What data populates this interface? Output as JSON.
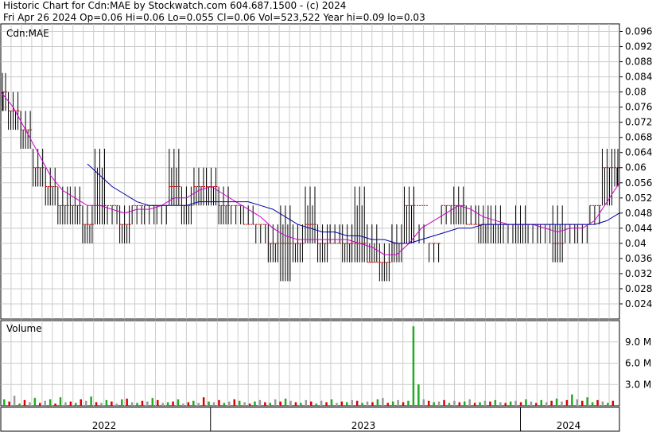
{
  "header": {
    "line1": "Historic Chart for Cdn:MAE by Stockwatch.com 604.687.1500 - (c) 2024",
    "line2": "Fri Apr 26 2024   Op=0.06   Hi=0.06   Lo=0.055   Cl=0.06   Vol=523,522   Year hi=0.09   lo=0.03"
  },
  "colors": {
    "price_bar": "#000000",
    "close_tick": "#cc0000",
    "ma_short": "#cc00cc",
    "ma_long": "#0000aa",
    "volume_up": "#22aa22",
    "volume_down": "#dd0000",
    "volume_flat": "#999999",
    "grid": "#cccccc"
  },
  "chart_data": [
    {
      "type": "bar",
      "title": "Cdn:MAE",
      "ylim": [
        0.02,
        0.098
      ],
      "y_ticks": [
        "0.096",
        "0.092",
        "0.088",
        "0.084",
        "0.08",
        "0.076",
        "0.072",
        "0.068",
        "0.064",
        "0.06",
        "0.056",
        "0.052",
        "0.048",
        "0.044",
        "0.04",
        "0.036",
        "0.032",
        "0.028",
        "0.024"
      ],
      "x_labels": [
        "2022",
        "2023",
        "2024"
      ],
      "x_boundaries": [
        0.0,
        0.339,
        0.84,
        1.0
      ],
      "grid": true,
      "series": [
        {
          "kind": "ohlc",
          "x": [
            0.0,
            0.02,
            0.04,
            0.06,
            0.08,
            0.1,
            0.12,
            0.14,
            0.16,
            0.18,
            0.2,
            0.22,
            0.24,
            0.26,
            0.28,
            0.3,
            0.32,
            0.34,
            0.36,
            0.38,
            0.4,
            0.42,
            0.44,
            0.46,
            0.48,
            0.5,
            0.52,
            0.54,
            0.56,
            0.58,
            0.6,
            0.62,
            0.64,
            0.66,
            0.68,
            0.7,
            0.72,
            0.74,
            0.76,
            0.78,
            0.8,
            0.82,
            0.84,
            0.86,
            0.88,
            0.9,
            0.92,
            0.94,
            0.96,
            0.98,
            1.0
          ],
          "high": [
            0.085,
            0.08,
            0.075,
            0.065,
            0.06,
            0.055,
            0.055,
            0.05,
            0.065,
            0.05,
            0.05,
            0.05,
            0.05,
            0.05,
            0.065,
            0.055,
            0.06,
            0.06,
            0.055,
            0.05,
            0.05,
            0.045,
            0.045,
            0.05,
            0.045,
            0.055,
            0.045,
            0.045,
            0.045,
            0.055,
            0.045,
            0.04,
            0.045,
            0.055,
            0.045,
            0.04,
            0.05,
            0.055,
            0.05,
            0.05,
            0.05,
            0.045,
            0.05,
            0.045,
            0.045,
            0.05,
            0.045,
            0.045,
            0.05,
            0.065,
            0.065
          ],
          "low": [
            0.075,
            0.07,
            0.065,
            0.055,
            0.05,
            0.045,
            0.045,
            0.04,
            0.045,
            0.045,
            0.04,
            0.045,
            0.045,
            0.045,
            0.05,
            0.045,
            0.05,
            0.05,
            0.045,
            0.045,
            0.045,
            0.04,
            0.035,
            0.03,
            0.035,
            0.04,
            0.035,
            0.04,
            0.035,
            0.035,
            0.035,
            0.03,
            0.035,
            0.04,
            0.045,
            0.035,
            0.045,
            0.045,
            0.045,
            0.04,
            0.04,
            0.04,
            0.04,
            0.04,
            0.04,
            0.035,
            0.04,
            0.04,
            0.045,
            0.05,
            0.055
          ],
          "close": [
            0.08,
            0.075,
            0.07,
            0.06,
            0.055,
            0.05,
            0.05,
            0.045,
            0.05,
            0.05,
            0.045,
            0.05,
            0.05,
            0.05,
            0.055,
            0.05,
            0.055,
            0.055,
            0.05,
            0.05,
            0.045,
            0.045,
            0.04,
            0.04,
            0.04,
            0.045,
            0.04,
            0.04,
            0.04,
            0.04,
            0.035,
            0.035,
            0.04,
            0.05,
            0.05,
            0.04,
            0.05,
            0.05,
            0.045,
            0.045,
            0.045,
            0.045,
            0.045,
            0.045,
            0.045,
            0.04,
            0.045,
            0.045,
            0.05,
            0.06,
            0.06
          ]
        },
        {
          "kind": "line",
          "values": [
            0.08,
            0.076,
            0.07,
            0.064,
            0.058,
            0.054,
            0.052,
            0.05,
            0.05,
            0.049,
            0.048,
            0.049,
            0.049,
            0.05,
            0.052,
            0.052,
            0.054,
            0.055,
            0.053,
            0.051,
            0.049,
            0.047,
            0.044,
            0.042,
            0.041,
            0.041,
            0.041,
            0.041,
            0.041,
            0.04,
            0.039,
            0.037,
            0.037,
            0.04,
            0.044,
            0.046,
            0.048,
            0.05,
            0.049,
            0.047,
            0.046,
            0.045,
            0.045,
            0.045,
            0.044,
            0.043,
            0.044,
            0.044,
            0.046,
            0.051,
            0.056
          ]
        },
        {
          "kind": "line",
          "values": [
            null,
            null,
            null,
            null,
            null,
            null,
            null,
            0.061,
            0.058,
            0.055,
            0.053,
            0.051,
            0.05,
            0.05,
            0.05,
            0.05,
            0.051,
            0.051,
            0.051,
            0.051,
            0.051,
            0.05,
            0.049,
            0.047,
            0.045,
            0.044,
            0.043,
            0.043,
            0.042,
            0.042,
            0.041,
            0.041,
            0.04,
            0.04,
            0.041,
            0.042,
            0.043,
            0.044,
            0.044,
            0.045,
            0.045,
            0.045,
            0.045,
            0.045,
            0.045,
            0.045,
            0.045,
            0.045,
            0.045,
            0.046,
            0.048
          ]
        }
      ]
    },
    {
      "type": "bar",
      "title": "Volume",
      "ylim": [
        0,
        12
      ],
      "y_ticks": [
        "9.0 M",
        "6.0 M",
        "3.0 M"
      ],
      "values": [
        0.9,
        0.6,
        1.4,
        0.3,
        0.8,
        0.5,
        1.1,
        0.4,
        0.7,
        0.9,
        0.3,
        1.2,
        0.5,
        0.6,
        0.4,
        0.9,
        0.7,
        1.3,
        0.5,
        0.4,
        0.8,
        0.6,
        0.3,
        0.9,
        1.0,
        0.5,
        0.4,
        0.7,
        0.6,
        1.1,
        0.8,
        0.4,
        0.5,
        0.6,
        0.9,
        0.3,
        0.5,
        0.7,
        0.4,
        1.2,
        0.6,
        0.5,
        0.8,
        0.4,
        0.6,
        0.9,
        0.7,
        0.5,
        0.3,
        0.6,
        0.8,
        0.5,
        0.4,
        0.9,
        0.6,
        1.0,
        0.7,
        0.5,
        0.4,
        0.8,
        0.6,
        0.3,
        0.7,
        0.5,
        0.9,
        0.4,
        0.6,
        0.5,
        0.8,
        0.7,
        0.4,
        0.6,
        0.5,
        0.9,
        1.1,
        0.4,
        0.6,
        0.8,
        0.5,
        0.7,
        11.2,
        3.0,
        0.9,
        0.7,
        0.5,
        0.6,
        0.8,
        0.4,
        0.7,
        0.5,
        0.6,
        0.9,
        0.4,
        0.5,
        0.7,
        0.6,
        0.8,
        0.5,
        0.4,
        0.6,
        0.7,
        0.5,
        0.9,
        0.6,
        0.4,
        0.8,
        0.5,
        0.7,
        1.0,
        0.6,
        0.8,
        1.6,
        0.9,
        0.7,
        1.2,
        0.5,
        0.8,
        0.6,
        0.4,
        0.7
      ],
      "directions": [
        "u",
        "d",
        "f",
        "u",
        "d",
        "f",
        "u",
        "d",
        "f",
        "u",
        "d",
        "u",
        "f",
        "d",
        "u",
        "d",
        "f",
        "u",
        "d",
        "f",
        "u",
        "d",
        "f",
        "u",
        "d",
        "f",
        "u",
        "d",
        "f",
        "u",
        "d",
        "f",
        "u",
        "d",
        "u",
        "f",
        "d",
        "u",
        "f",
        "d",
        "u",
        "f",
        "d",
        "u",
        "f",
        "d",
        "u",
        "f",
        "d",
        "u",
        "f",
        "d",
        "u",
        "f",
        "d",
        "u",
        "f",
        "d",
        "u",
        "f",
        "d",
        "u",
        "f",
        "d",
        "u",
        "f",
        "d",
        "u",
        "f",
        "d",
        "u",
        "f",
        "d",
        "u",
        "f",
        "d",
        "u",
        "f",
        "d",
        "u",
        "u",
        "u",
        "f",
        "d",
        "u",
        "f",
        "d",
        "u",
        "f",
        "d",
        "u",
        "f",
        "d",
        "u",
        "f",
        "d",
        "u",
        "f",
        "d",
        "u",
        "f",
        "d",
        "u",
        "f",
        "d",
        "u",
        "f",
        "d",
        "u",
        "f",
        "d",
        "u",
        "f",
        "d",
        "u",
        "u",
        "d",
        "f",
        "u",
        "d",
        "f"
      ]
    }
  ]
}
